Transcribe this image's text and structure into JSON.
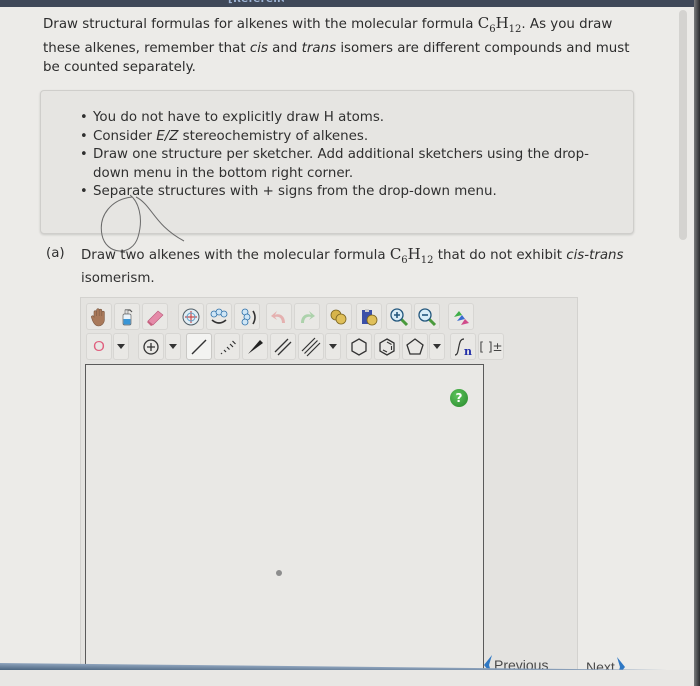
{
  "header": {
    "references_link": "[References]"
  },
  "intro": {
    "text_before_formula": "Draw structural formulas for alkenes with the molecular formula ",
    "formula": {
      "c": "C",
      "c_sub": "6",
      "h": "H",
      "h_sub": "12"
    },
    "text_after_formula_1": ". As you draw these alkenes, remember that ",
    "cis": "cis",
    "and": " and ",
    "trans": "trans",
    "text_after_formula_2": " isomers are different compounds and must be counted separately."
  },
  "hints": {
    "items": [
      {
        "text": "You do not have to explicitly draw H atoms."
      },
      {
        "prefix": "Consider ",
        "italic": "E/Z",
        "suffix": " stereochemistry of alkenes."
      },
      {
        "text": "Draw one structure per sketcher. Add additional sketchers using the drop-down menu in the bottom right corner."
      },
      {
        "text": "Separate structures with + signs from the drop-down menu."
      }
    ],
    "bullet": "•"
  },
  "question": {
    "label": "(a)",
    "text_before": "Draw two alkenes with the molecular formula ",
    "text_after": " that do not exhibit ",
    "italic": "cis-trans",
    "text_end": " isomerism."
  },
  "sketcher": {
    "toolbar_row1": [
      {
        "name": "hand-tool",
        "icon": "hand-icon"
      },
      {
        "name": "clear-tool",
        "icon": "spray-bottle-icon"
      },
      {
        "name": "eraser-tool",
        "icon": "eraser-icon"
      },
      {
        "name": "center-tool",
        "icon": "center-molecule-icon"
      },
      {
        "name": "rotate-horizontal-tool",
        "icon": "flip-horizontal-icon"
      },
      {
        "name": "rotate-vertical-tool",
        "icon": "flip-vertical-icon"
      },
      {
        "name": "undo-button",
        "icon": "undo-icon"
      },
      {
        "name": "redo-button",
        "icon": "redo-icon"
      },
      {
        "name": "copy-button",
        "icon": "copy-icon"
      },
      {
        "name": "paste-button",
        "icon": "paste-icon"
      },
      {
        "name": "zoom-in-button",
        "icon": "zoom-in-icon"
      },
      {
        "name": "zoom-out-button",
        "icon": "zoom-out-icon"
      },
      {
        "name": "clean-structure-button",
        "icon": "clean-icon"
      }
    ],
    "toolbar_row2": [
      {
        "name": "atom-tool",
        "icon": "atom-icon",
        "label": "O"
      },
      {
        "name": "atom-dropdown",
        "icon": "dropdown-arrow-icon"
      },
      {
        "name": "charge-tool",
        "icon": "plus-circle-icon",
        "label": "⊕"
      },
      {
        "name": "charge-dropdown",
        "icon": "dropdown-arrow-icon"
      },
      {
        "name": "single-bond-tool",
        "icon": "single-bond-icon"
      },
      {
        "name": "hash-bond-tool",
        "icon": "hash-bond-icon"
      },
      {
        "name": "wedge-bond-tool",
        "icon": "wedge-bond-icon"
      },
      {
        "name": "double-bond-tool",
        "icon": "double-bond-icon"
      },
      {
        "name": "triple-bond-tool",
        "icon": "triple-bond-icon"
      },
      {
        "name": "bond-dropdown",
        "icon": "dropdown-arrow-icon"
      },
      {
        "name": "cyclohexane-tool",
        "icon": "hexagon-icon"
      },
      {
        "name": "benzene-tool",
        "icon": "benzene-icon"
      },
      {
        "name": "cyclopentane-tool",
        "icon": "pentagon-icon"
      },
      {
        "name": "ring-dropdown",
        "icon": "dropdown-arrow-icon"
      },
      {
        "name": "sgroup-tool",
        "icon": "sgroup-icon",
        "label": "n"
      },
      {
        "name": "bracket-tool",
        "icon": "bracket-charge-icon",
        "label": "[ ]±"
      }
    ],
    "help_label": "?",
    "colors": {
      "help": "#2e9a32",
      "nav_arrow": "#2f78c4"
    }
  },
  "navigation": {
    "previous": "Previous",
    "next": "Next"
  }
}
